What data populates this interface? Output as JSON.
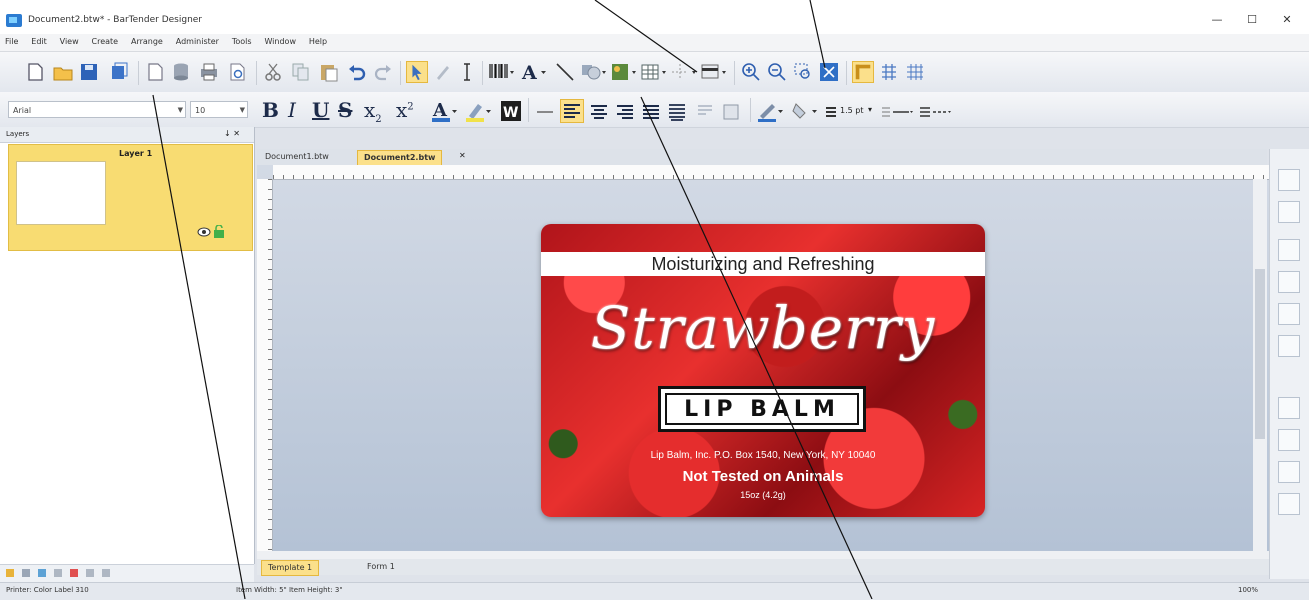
{
  "window": {
    "title": "Document2.btw* - BarTender Designer",
    "controls": {
      "minimize": "—",
      "maximize": "☐",
      "close": "✕"
    }
  },
  "menu": [
    "File",
    "Edit",
    "View",
    "Create",
    "Arrange",
    "Administer",
    "Tools",
    "Window",
    "Help"
  ],
  "format_bar": {
    "font_name": "Arial",
    "font_size": "10",
    "line_weight": "1.5 pt"
  },
  "layers_panel": {
    "title": "Layers",
    "header_controls": "↓ ✕",
    "layer_name": "Layer 1"
  },
  "doc_tabs": [
    {
      "label": "Document1.btw",
      "active": false
    },
    {
      "label": "Document2.btw",
      "active": true
    }
  ],
  "doc_tab_close": "✕",
  "bottom_tabs": [
    "Template 1",
    "Form 1"
  ],
  "status": {
    "printer": "Printer: Color Label 310",
    "item_size": "Item Width: 5\"  Item Height: 3\"",
    "zoom": "100%"
  },
  "label": {
    "tagline": "Moisturizing and Refreshing",
    "product": "Strawberry",
    "category": "LIP BALM",
    "address": "Lip Balm, Inc. P.O. Box 1540, New York, NY 10040",
    "claim": "Not Tested on Animals",
    "weight": "15oz (4.2g)"
  },
  "colors": {
    "accent": "#f8dc72",
    "label_red": "#d72424",
    "canvas": "#c4cfdd"
  }
}
